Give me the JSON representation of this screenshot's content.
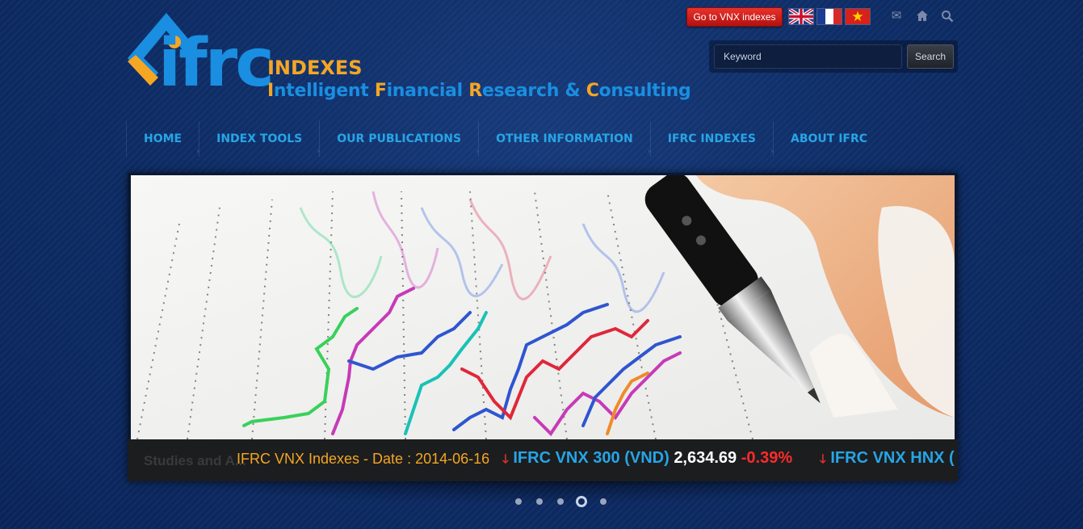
{
  "brand": {
    "wordmark": "ifrc",
    "title": "INDEXES",
    "subtitle_parts": [
      {
        "text": "I",
        "hl": true
      },
      {
        "text": "ntelligent ",
        "hl": false
      },
      {
        "text": "F",
        "hl": true
      },
      {
        "text": "inancial ",
        "hl": false
      },
      {
        "text": "R",
        "hl": true
      },
      {
        "text": "esearch & ",
        "hl": false
      },
      {
        "text": "C",
        "hl": true
      },
      {
        "text": "onsulting",
        "hl": false
      }
    ],
    "colors": {
      "blue": "#1a8ee0",
      "orange": "#f5a623"
    }
  },
  "topbar": {
    "vnx_button": "Go to VNX indexes",
    "languages": [
      "English",
      "Français",
      "Tiếng Việt"
    ],
    "icons": [
      "mail-icon",
      "home-icon",
      "search-icon"
    ]
  },
  "search": {
    "placeholder": "Keyword",
    "button": "Search"
  },
  "nav": {
    "items": [
      {
        "label": "HOME"
      },
      {
        "label": "INDEX TOOLS"
      },
      {
        "label": "OUR PUBLICATIONS"
      },
      {
        "label": "OTHER INFORMATION"
      },
      {
        "label": "IFRC INDEXES"
      },
      {
        "label": "ABOUT IFRC"
      }
    ]
  },
  "slider": {
    "caption_ghost": "Studies and A...",
    "ticker": {
      "date_text": "IFRC VNX Indexes - Date : 2014-06-16",
      "items": [
        {
          "name": "IFRC VNX 300 (VND)",
          "value": "2,634.69",
          "change": "-0.39%",
          "direction": "down"
        },
        {
          "name": "IFRC VNX HNX (",
          "value": "",
          "change": "",
          "direction": "down"
        }
      ]
    },
    "pages": 5,
    "active_page": 4
  }
}
